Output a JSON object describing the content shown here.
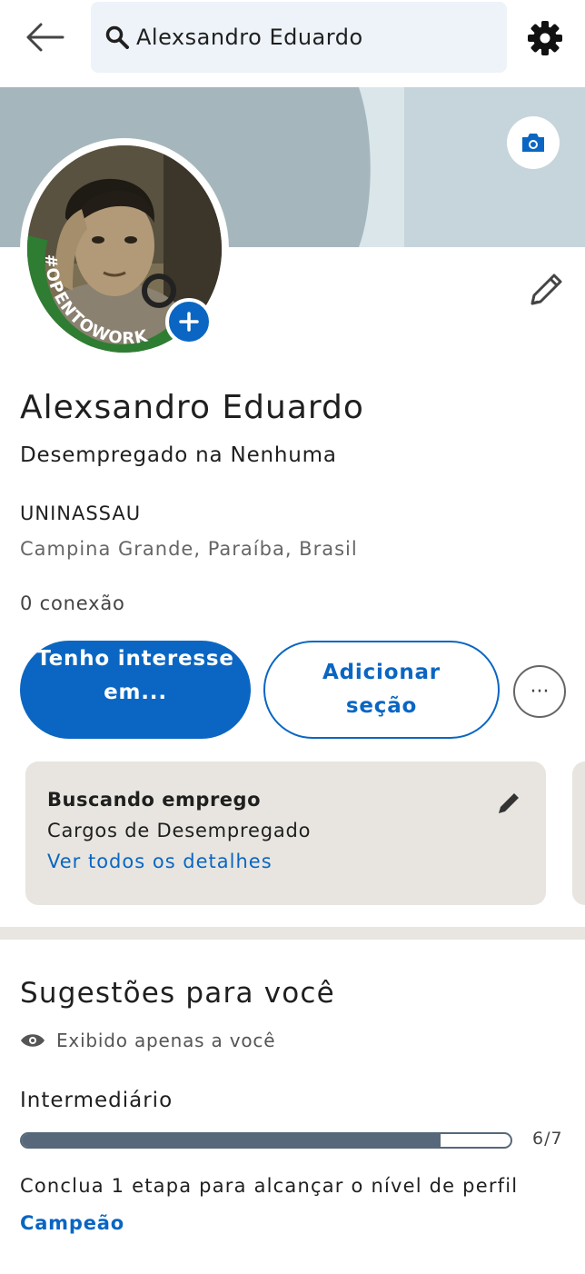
{
  "header": {
    "search_value": "Alexsandro Eduardo",
    "icons": {
      "back": "arrow-left-icon",
      "search": "search-icon",
      "settings": "gear-icon"
    }
  },
  "banner": {
    "camera_icon": "camera-icon"
  },
  "avatar": {
    "badge_text": "#OPENTOWORK",
    "add_icon": "plus-icon"
  },
  "profile": {
    "name": "Alexsandro Eduardo",
    "headline": "Desempregado na Nenhuma",
    "school": "UNINASSAU",
    "location": "Campina Grande, Paraíba, Brasil",
    "connections": "0 conexão"
  },
  "actions": {
    "primary_label": "Tenho interesse em...",
    "secondary_label": "Adicionar seção",
    "more_label": "···"
  },
  "open_to_work_card": {
    "title": "Buscando emprego",
    "roles": "Cargos de Desempregado",
    "link": "Ver todos os detalhes"
  },
  "suggestions": {
    "title": "Sugestões para você",
    "private_note": "Exibido apenas a você",
    "level": "Intermediário",
    "progress": {
      "completed": 6,
      "total": 7,
      "label": "6/7"
    },
    "prompt": "Conclua 1 etapa para alcançar o nível de perfil",
    "prompt_link": "Campeão"
  },
  "colors": {
    "brand": "#0a66c2",
    "progress": "#56687a",
    "otw_green": "#2e7d32",
    "card_bg": "#e8e5e0"
  }
}
